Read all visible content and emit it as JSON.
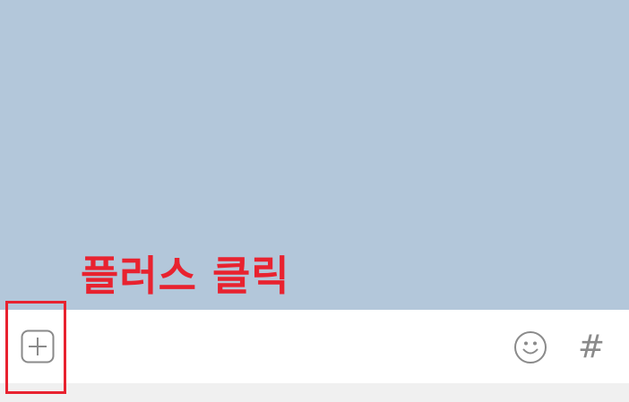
{
  "annotation": {
    "label": "플러스 클릭",
    "color": "#e8222f"
  },
  "chat": {
    "background_color": "#b3c7da"
  },
  "input_bar": {
    "plus_icon": "plus-square-icon",
    "emoji_icon": "smiley-icon",
    "hash_label": "#",
    "icon_color": "#8a8a8a"
  }
}
